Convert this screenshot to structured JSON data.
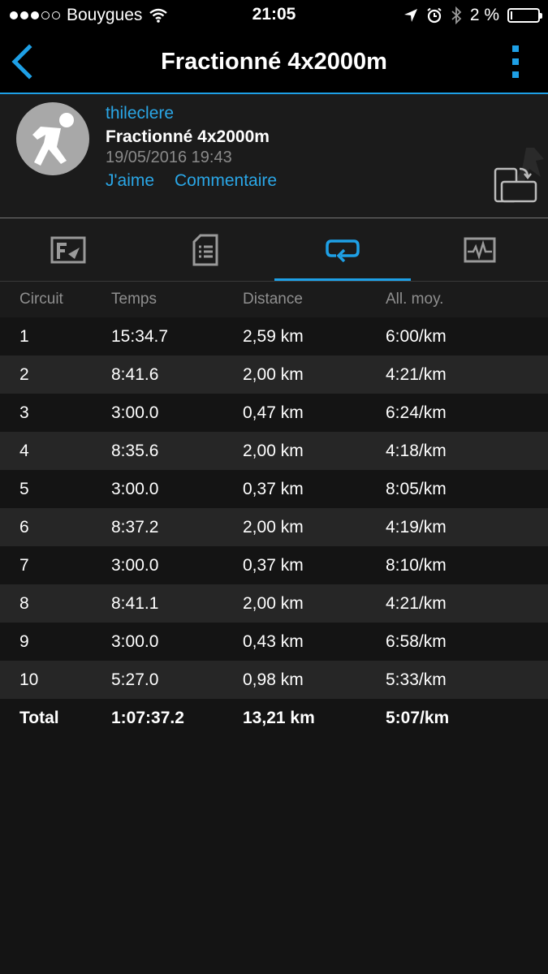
{
  "status_bar": {
    "carrier": "Bouygues",
    "time": "21:05",
    "battery": "2 %",
    "battery_level_percent": 2
  },
  "nav": {
    "title": "Fractionné 4x2000m"
  },
  "activity": {
    "user": "thileclere",
    "name": "Fractionné 4x2000m",
    "date": "19/05/2016 19:43",
    "like_label": "J'aime",
    "comment_label": "Commentaire"
  },
  "tabs": [
    {
      "icon": "map-icon",
      "active": false
    },
    {
      "icon": "details-icon",
      "active": false
    },
    {
      "icon": "laps-icon",
      "active": true
    },
    {
      "icon": "chart-icon",
      "active": false
    }
  ],
  "accent_color": "#1ea0e6",
  "table": {
    "headers": [
      "Circuit",
      "Temps",
      "Distance",
      "All. moy."
    ],
    "rows": [
      [
        "1",
        "15:34.7",
        "2,59 km",
        "6:00/km"
      ],
      [
        "2",
        "8:41.6",
        "2,00 km",
        "4:21/km"
      ],
      [
        "3",
        "3:00.0",
        "0,47 km",
        "6:24/km"
      ],
      [
        "4",
        "8:35.6",
        "2,00 km",
        "4:18/km"
      ],
      [
        "5",
        "3:00.0",
        "0,37 km",
        "8:05/km"
      ],
      [
        "6",
        "8:37.2",
        "2,00 km",
        "4:19/km"
      ],
      [
        "7",
        "3:00.0",
        "0,37 km",
        "8:10/km"
      ],
      [
        "8",
        "8:41.1",
        "2,00 km",
        "4:21/km"
      ],
      [
        "9",
        "3:00.0",
        "0,43 km",
        "6:58/km"
      ],
      [
        "10",
        "5:27.0",
        "0,98 km",
        "5:33/km"
      ]
    ],
    "total": [
      "Total",
      "1:07:37.2",
      "13,21 km",
      "5:07/km"
    ]
  }
}
